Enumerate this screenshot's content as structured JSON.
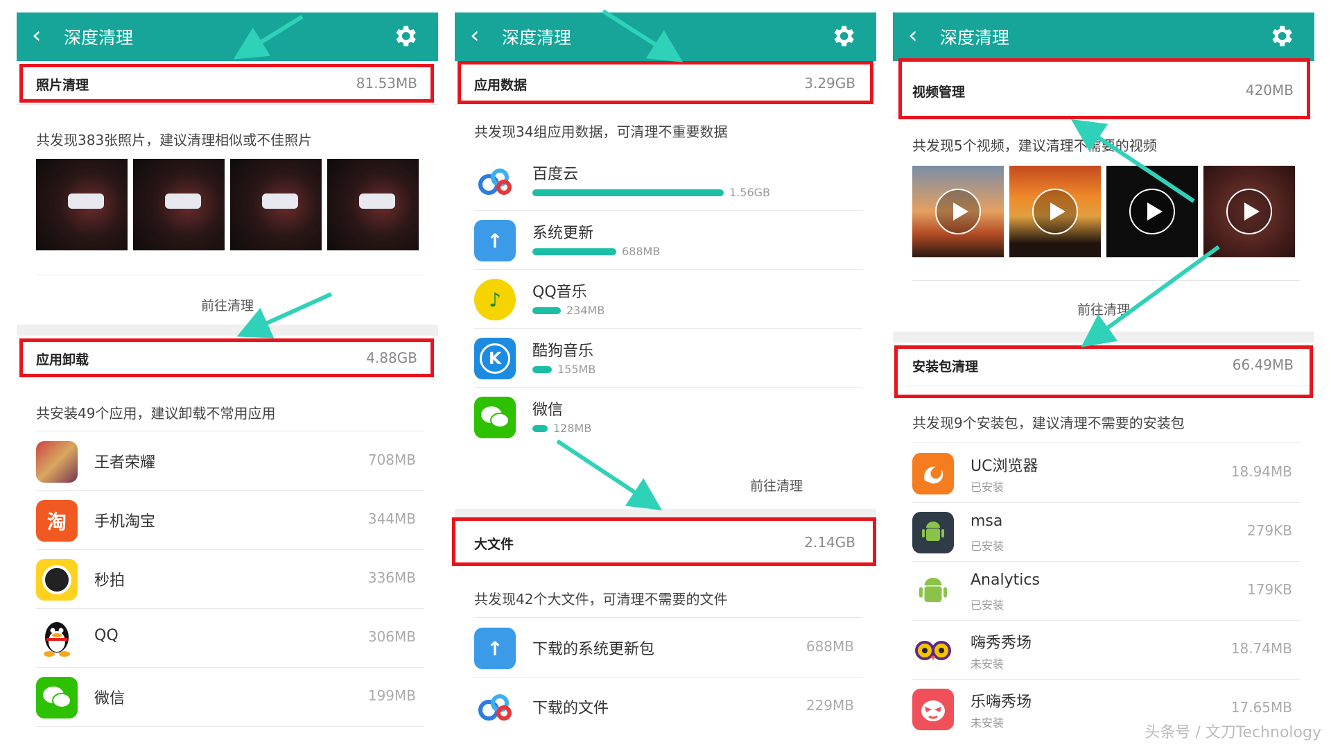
{
  "panel1": {
    "title": "深度清理",
    "photo": {
      "name": "照片清理",
      "size": "81.53MB",
      "desc": "共发现383张照片，建议清理相似或不佳照片"
    },
    "goto": "前往清理",
    "apps": {
      "name": "应用卸载",
      "size": "4.88GB",
      "desc": "共安装49个应用，建议卸载不常用应用"
    },
    "items": [
      {
        "label": "王者荣耀",
        "value": "708MB",
        "icon": "game-icon",
        "color": "#c9a15a"
      },
      {
        "label": "手机淘宝",
        "value": "344MB",
        "icon": "taobao-icon",
        "color": "#f05a22",
        "glyph": "淘"
      },
      {
        "label": "秒拍",
        "value": "336MB",
        "icon": "camera-icon",
        "color": "#ffd21f"
      },
      {
        "label": "QQ",
        "value": "306MB",
        "icon": "penguin-icon",
        "color": "#ffffff"
      },
      {
        "label": "微信",
        "value": "199MB",
        "icon": "wechat-icon",
        "color": "#2dc100"
      }
    ]
  },
  "panel2": {
    "title": "深度清理",
    "appdata": {
      "name": "应用数据",
      "size": "3.29GB",
      "desc": "共发现34组应用数据，可清理不重要数据"
    },
    "items": [
      {
        "label": "百度云",
        "value": "1.56GB",
        "fraction": 1.0,
        "icon": "cloud-icon",
        "color": "#ffffff"
      },
      {
        "label": "系统更新",
        "value": "688MB",
        "fraction": 0.44,
        "icon": "update-icon",
        "color": "#3b9be8"
      },
      {
        "label": "QQ音乐",
        "value": "234MB",
        "fraction": 0.15,
        "icon": "music-icon",
        "color": "#f5d400"
      },
      {
        "label": "酷狗音乐",
        "value": "155MB",
        "fraction": 0.1,
        "icon": "kugou-icon",
        "color": "#1d8ce0",
        "glyph": "K"
      },
      {
        "label": "微信",
        "value": "128MB",
        "fraction": 0.08,
        "icon": "wechat-icon",
        "color": "#2dc100"
      }
    ],
    "goto": "前往清理",
    "bigfile": {
      "name": "大文件",
      "size": "2.14GB",
      "desc": "共发现42个大文件，可清理不需要的文件"
    },
    "files": [
      {
        "label": "下载的系统更新包",
        "value": "688MB",
        "icon": "update-icon",
        "color": "#3b9be8"
      },
      {
        "label": "下载的文件",
        "value": "229MB",
        "icon": "cloud-icon",
        "color": "#ffffff"
      }
    ]
  },
  "panel3": {
    "title": "深度清理",
    "video": {
      "name": "视频管理",
      "size": "420MB",
      "desc": "共发现5个视频，建议清理不需要的视频"
    },
    "goto": "前往清理",
    "apk": {
      "name": "安装包清理",
      "size": "66.49MB",
      "desc": "共发现9个安装包，建议清理不需要的安装包"
    },
    "items": [
      {
        "label": "UC浏览器",
        "status": "已安装",
        "value": "18.94MB",
        "icon": "uc-browser-icon",
        "color": "#f57c1f"
      },
      {
        "label": "msa",
        "status": "已安装",
        "value": "279KB",
        "icon": "android-icon",
        "color": "#2f3b47"
      },
      {
        "label": "Analytics",
        "status": "已安装",
        "value": "179KB",
        "icon": "android-icon",
        "color": "#ffffff"
      },
      {
        "label": "嗨秀秀场",
        "status": "未安装",
        "value": "18.74MB",
        "icon": "owl-icon",
        "color": "#ffffff"
      },
      {
        "label": "乐嗨秀场",
        "status": "未安装",
        "value": "17.65MB",
        "icon": "mask-icon",
        "color": "#f0505a"
      }
    ]
  },
  "watermark": "头条号 / 文刀Technology"
}
